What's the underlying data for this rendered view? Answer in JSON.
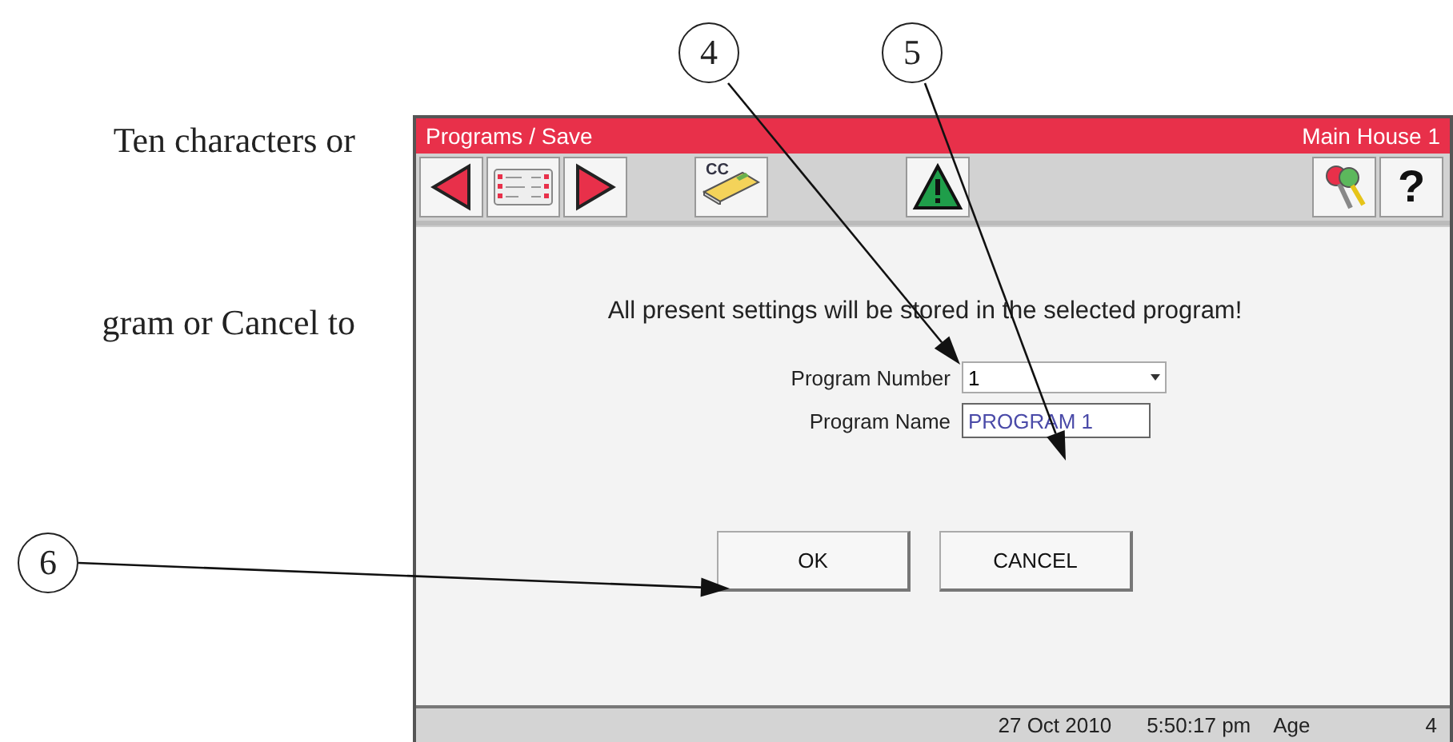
{
  "manual_text": [
    "Ten characters or",
    "gram or Cancel to"
  ],
  "callouts": [
    {
      "number": "4"
    },
    {
      "number": "5"
    },
    {
      "number": "6"
    }
  ],
  "window": {
    "title": "Programs / Save",
    "location": "Main House 1"
  },
  "toolbar": [
    {
      "kind": "back"
    },
    {
      "kind": "list"
    },
    {
      "kind": "forward"
    },
    {
      "kind": "cc",
      "label": "CC"
    },
    {
      "kind": "alarm"
    },
    {
      "kind": "keys"
    },
    {
      "kind": "help",
      "label": "?"
    }
  ],
  "message": "All present settings will be stored in the selected program!",
  "fields": [
    {
      "label": "Program Number",
      "kind": "dropdown",
      "value": "1"
    },
    {
      "label": "Program Name",
      "kind": "text",
      "value": "PROGRAM 1"
    }
  ],
  "buttons": [
    "OK",
    "CANCEL"
  ],
  "status_bar": {
    "date": "27 Oct 2010",
    "time": "5:50:17 pm",
    "label": "Age",
    "value": "4"
  }
}
